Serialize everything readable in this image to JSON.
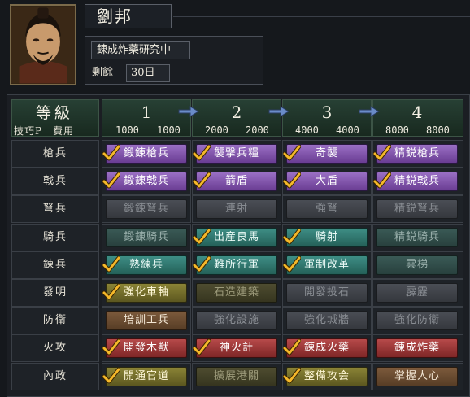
{
  "character": {
    "name": "劉邦",
    "status": "錬成炸藥研究中",
    "remaining_label": "剰餘",
    "remaining_value": "30日"
  },
  "table": {
    "title": "等級",
    "skill_points_label": "技巧P　費用",
    "levels": [
      {
        "number": "1",
        "cost_a": "1000",
        "cost_b": "1000"
      },
      {
        "number": "2",
        "cost_a": "2000",
        "cost_b": "2000"
      },
      {
        "number": "3",
        "cost_a": "4000",
        "cost_b": "4000"
      },
      {
        "number": "4",
        "cost_a": "8000",
        "cost_b": "8000"
      }
    ],
    "rows": [
      {
        "label": "槍兵",
        "techs": [
          {
            "name": "鍛錬槍兵",
            "color": "purple",
            "done": true
          },
          {
            "name": "襲撃兵糧",
            "color": "purple",
            "done": true
          },
          {
            "name": "奇襲",
            "color": "purple",
            "done": true
          },
          {
            "name": "精鋭槍兵",
            "color": "purple",
            "done": true
          }
        ]
      },
      {
        "label": "戟兵",
        "techs": [
          {
            "name": "鍛錬戟兵",
            "color": "purple",
            "done": true
          },
          {
            "name": "箭盾",
            "color": "purple",
            "done": true
          },
          {
            "name": "大盾",
            "color": "purple",
            "done": true
          },
          {
            "name": "精鋭戟兵",
            "color": "purple",
            "done": true
          }
        ]
      },
      {
        "label": "弩兵",
        "techs": [
          {
            "name": "鍛錬弩兵",
            "color": "grey",
            "done": false
          },
          {
            "name": "連射",
            "color": "grey",
            "done": false
          },
          {
            "name": "強弩",
            "color": "grey",
            "done": false
          },
          {
            "name": "精鋭弩兵",
            "color": "grey",
            "done": false
          }
        ]
      },
      {
        "label": "騎兵",
        "techs": [
          {
            "name": "鍛錬騎兵",
            "color": "dim-teal",
            "done": false
          },
          {
            "name": "出産良馬",
            "color": "teal",
            "done": true
          },
          {
            "name": "騎射",
            "color": "teal",
            "done": true
          },
          {
            "name": "精鋭騎兵",
            "color": "dim-teal",
            "done": false
          }
        ]
      },
      {
        "label": "錬兵",
        "techs": [
          {
            "name": "熟練兵",
            "color": "teal",
            "done": true
          },
          {
            "name": "難所行軍",
            "color": "teal",
            "done": true
          },
          {
            "name": "軍制改革",
            "color": "teal",
            "done": true
          },
          {
            "name": "雲梯",
            "color": "dim-teal",
            "done": false
          }
        ]
      },
      {
        "label": "發明",
        "techs": [
          {
            "name": "強化車軸",
            "color": "olive",
            "done": true
          },
          {
            "name": "石造建築",
            "color": "dim-olive",
            "done": false
          },
          {
            "name": "開發投石",
            "color": "grey",
            "done": false
          },
          {
            "name": "霹靂",
            "color": "grey",
            "done": false
          }
        ]
      },
      {
        "label": "防衛",
        "techs": [
          {
            "name": "培訓工兵",
            "color": "brown",
            "done": false
          },
          {
            "name": "強化設施",
            "color": "grey",
            "done": false
          },
          {
            "name": "強化城牆",
            "color": "grey",
            "done": false
          },
          {
            "name": "強化防衛",
            "color": "grey",
            "done": false
          }
        ]
      },
      {
        "label": "火攻",
        "techs": [
          {
            "name": "開發木獣",
            "color": "red",
            "done": true
          },
          {
            "name": "神火計",
            "color": "red",
            "done": true
          },
          {
            "name": "錬成火藥",
            "color": "red",
            "done": true
          },
          {
            "name": "錬成炸藥",
            "color": "red",
            "done": false
          }
        ]
      },
      {
        "label": "內政",
        "techs": [
          {
            "name": "開通官道",
            "color": "olive",
            "done": true
          },
          {
            "name": "擴展港關",
            "color": "dim-olive",
            "done": false
          },
          {
            "name": "整備攻会",
            "color": "olive",
            "done": true
          },
          {
            "name": "掌握人心",
            "color": "brown",
            "done": false
          }
        ]
      }
    ]
  }
}
